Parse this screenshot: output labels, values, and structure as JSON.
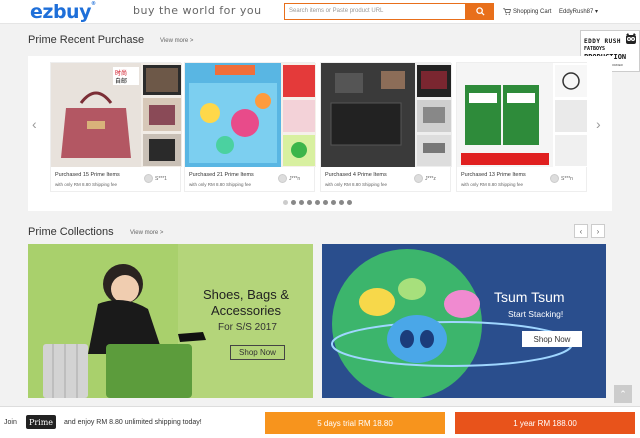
{
  "header": {
    "logo": "ezbuy",
    "tagline": "buy the world for you",
    "search_placeholder": "Search items or Paste product URL",
    "cart_label": "Shopping Cart",
    "username": "EddyRush87"
  },
  "badge": {
    "line1": "EDDY RUSH",
    "line2": "FATBOYS",
    "line3": "PRODUCTION",
    "line4": "LIFESTYLE RECORDER"
  },
  "recent": {
    "title": "Prime Recent Purchase",
    "view_more": "View more >",
    "cards": [
      {
        "purchased": "Purchased 15 Prime Items",
        "shipping": "with only RM 8.80 Shipping fee",
        "user": "S***1"
      },
      {
        "purchased": "Purchased 21 Prime Items",
        "shipping": "with only RM 8.80 Shipping fee",
        "user": "J***n"
      },
      {
        "purchased": "Purchased 4 Prime Items",
        "shipping": "with only RM 8.80 Shipping fee",
        "user": "J***z"
      },
      {
        "purchased": "Purchased 13 Prime Items",
        "shipping": "with only RM 8.80 Shipping fee",
        "user": "S***n"
      }
    ],
    "prev_arrow": "‹",
    "next_arrow": "›"
  },
  "collections": {
    "title": "Prime Collections",
    "view_more": "View more >",
    "prev_arrow": "‹",
    "next_arrow": "›",
    "banner1": {
      "title": "Shoes, Bags & Accessories",
      "subtitle": "For S/S 2017",
      "button": "Shop Now"
    },
    "banner2": {
      "title": "Tsum Tsum",
      "subtitle": "Start Stacking!",
      "button": "Shop Now"
    }
  },
  "scroll_top": "⌃",
  "bottom": {
    "join": "Join",
    "prime": "Prime",
    "enjoy": "and enjoy RM 8.80 unlimited shipping today!",
    "trial": "5 days trial RM 18.80",
    "year": "1 year RM 188.00"
  },
  "colors": {
    "accent": "#e86f1b",
    "brand": "#1e6fd9",
    "trial": "#f7941d",
    "year": "#e8531b"
  }
}
